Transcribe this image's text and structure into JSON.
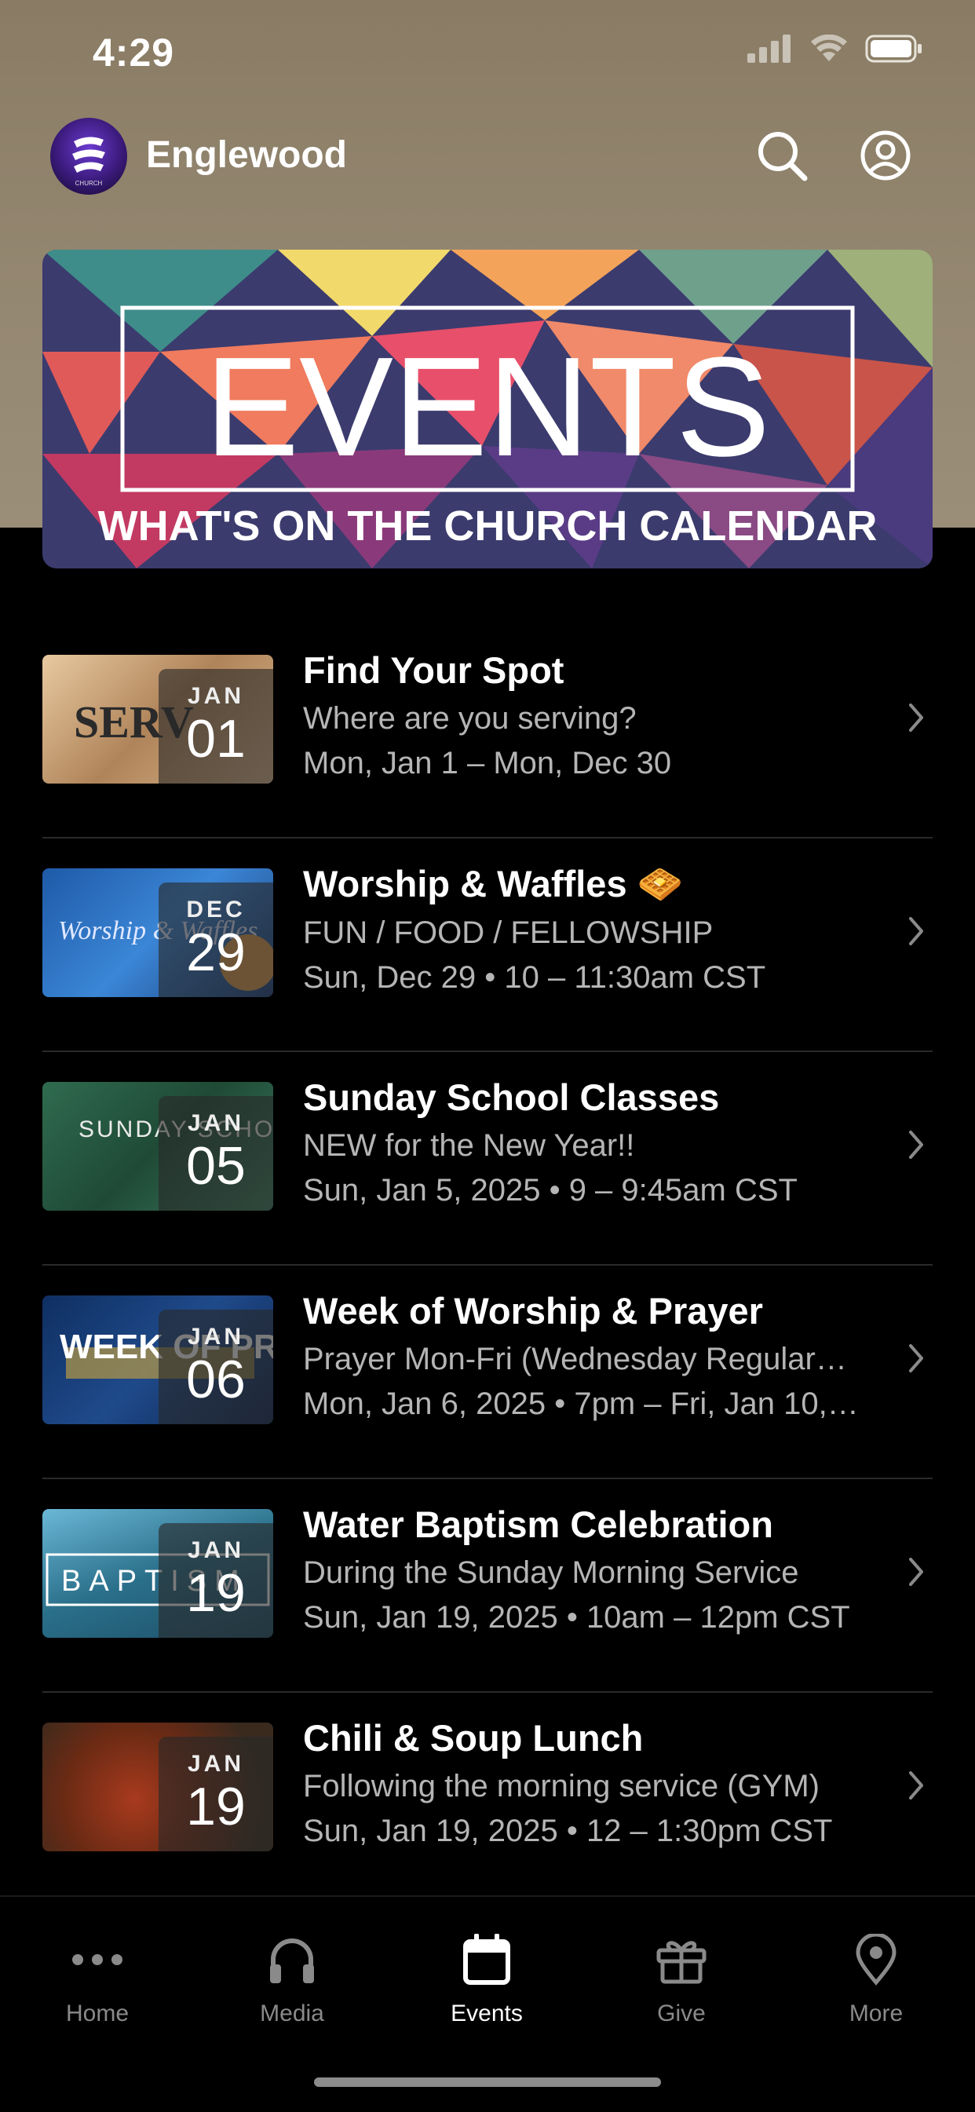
{
  "status_bar": {
    "time": "4:29"
  },
  "header": {
    "app_name": "Englewood",
    "logo_text": "CHURCH"
  },
  "banner": {
    "title": "EVENTS",
    "subtitle": "WHAT'S ON THE CHURCH CALENDAR"
  },
  "events": [
    {
      "title": "Find Your Spot",
      "subtitle": "Where are you serving?",
      "when": "Mon, Jan 1 – Mon, Dec 30",
      "month": "JAN",
      "day": "01",
      "thumb_text": "SERV",
      "thumb_color": "#c9a37a"
    },
    {
      "title": "Worship & Waffles 🧇",
      "subtitle": "FUN / FOOD / FELLOWSHIP",
      "when": "Sun, Dec 29 • 10 – 11:30am CST",
      "month": "DEC",
      "day": "29",
      "thumb_text": "Worship & Waffles",
      "thumb_color": "#1f5fa8"
    },
    {
      "title": "Sunday School Classes",
      "subtitle": "NEW for the New Year!!",
      "when": "Sun, Jan 5, 2025 • 9 – 9:45am CST",
      "month": "JAN",
      "day": "05",
      "thumb_text": "SUNDAY SCHOOL",
      "thumb_color": "#2d5c45"
    },
    {
      "title": "Week of Worship & Prayer",
      "subtitle": "Prayer Mon-Fri (Wednesday Regular…",
      "when": "Mon, Jan 6, 2025 • 7pm – Fri, Jan 10,…",
      "month": "JAN",
      "day": "06",
      "thumb_text": "WEEK OF PRAYER",
      "thumb_color": "#163a6e"
    },
    {
      "title": "Water Baptism Celebration",
      "subtitle": "During the Sunday Morning Service",
      "when": "Sun, Jan 19, 2025 • 10am – 12pm CST",
      "month": "JAN",
      "day": "19",
      "thumb_text": "BAPTISM",
      "thumb_color": "#2a6f8a"
    },
    {
      "title": "Chili & Soup Lunch",
      "subtitle": "Following the morning service (GYM)",
      "when": "Sun, Jan 19, 2025 • 12 – 1:30pm CST",
      "month": "JAN",
      "day": "19",
      "thumb_text": "",
      "thumb_color": "#7a3a1e"
    }
  ],
  "tabs": [
    {
      "label": "Home",
      "icon": "ellipsis-icon",
      "active": false
    },
    {
      "label": "Media",
      "icon": "headphones-icon",
      "active": false
    },
    {
      "label": "Events",
      "icon": "calendar-icon",
      "active": true
    },
    {
      "label": "Give",
      "icon": "gift-icon",
      "active": false
    },
    {
      "label": "More",
      "icon": "location-pin-icon",
      "active": false
    }
  ]
}
